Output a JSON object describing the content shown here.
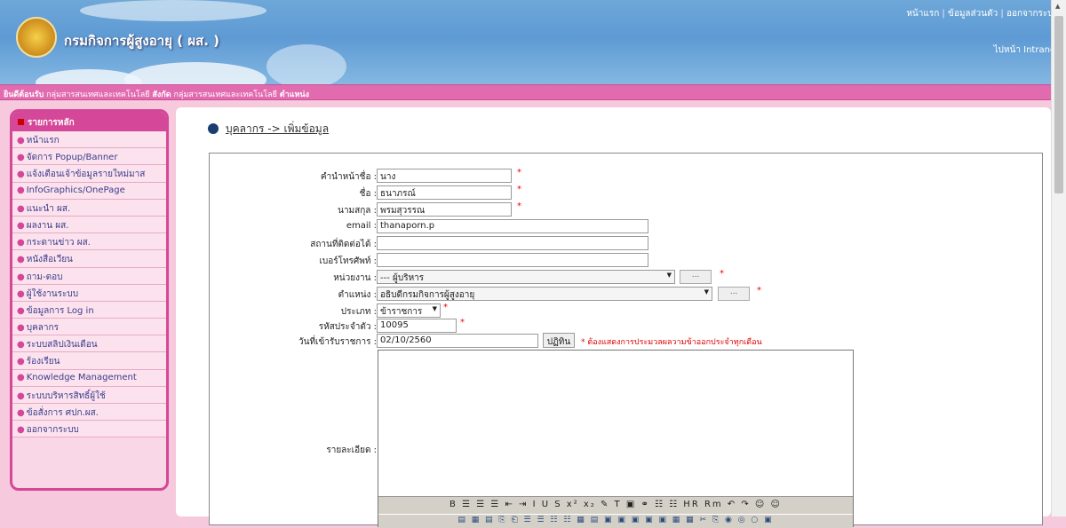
{
  "header": {
    "site_title": "กรมกิจการผู้สูงอายุ ( ผส. )",
    "top_links": [
      "หน้าแรก",
      "ข้อมูลส่วนตัว",
      "ออกจากระบบ"
    ],
    "intranet_link": "ไปหน้า Intranet"
  },
  "welcome_bar": {
    "welcome_label": "ยินดีต้อนรับ",
    "welcome_value": "กลุ่มสารสนเทศและเทคโนโลยี",
    "dept_label": "สังกัด",
    "dept_value": "กลุ่มสารสนเทศและเทคโนโลยี",
    "position_label": "ตำแหน่ง"
  },
  "sidebar": {
    "title": "รายการหลัก",
    "items": [
      {
        "label": "หน้าแรก"
      },
      {
        "label": "จัดการ Popup/Banner"
      },
      {
        "label": "แจ้งเตือนเจ้าข้อมูลรายใหม่มาส"
      },
      {
        "label": "InfoGraphics/OnePage"
      },
      {
        "label": "แนะนำ ผส."
      },
      {
        "label": "ผลงาน ผส."
      },
      {
        "label": "กระดานข่าว ผส."
      },
      {
        "label": "หนังสือเวียน"
      },
      {
        "label": "ถาม-ตอบ"
      },
      {
        "label": "ผู้ใช้งานระบบ"
      },
      {
        "label": "ข้อมูลการ Log in"
      },
      {
        "label": "บุคลากร"
      },
      {
        "label": "ระบบสลิปเงินเดือน"
      },
      {
        "label": "ร้องเรียน"
      },
      {
        "label": "Knowledge Management"
      },
      {
        "label": "ระบบบริหารสิทธิ์ผู้ใช้"
      },
      {
        "label": "ข้อสั่งการ ศปก.ผส."
      },
      {
        "label": "ออกจากระบบ"
      }
    ]
  },
  "main": {
    "breadcrumb": "บุคลากร -> เพิ่มข้อมูล",
    "form": {
      "prefix": {
        "label": "คำนำหน้าชื่อ :",
        "value": "นาง"
      },
      "first_name": {
        "label": "ชื่อ :",
        "value": "ธนาภรณ์"
      },
      "last_name": {
        "label": "นามสกุล :",
        "value": "พรมสุวรรณ"
      },
      "email": {
        "label": "email :",
        "value": "thanaporn.p"
      },
      "address": {
        "label": "สถานที่ติดต่อได้ :",
        "value": ""
      },
      "phone": {
        "label": "เบอร์โทรศัพท์ :",
        "value": ""
      },
      "department": {
        "label": "หน่วยงาน :",
        "value": "--- ผู้บริหาร"
      },
      "position": {
        "label": "ตำแหน่ง :",
        "value": "อธิบดีกรมกิจการผู้สูงอายุ"
      },
      "type": {
        "label": "ประเภท :",
        "value": "ข้าราชการ"
      },
      "employee_id": {
        "label": "รหัสประจำตัว :",
        "value": "10095"
      },
      "start_date": {
        "label": "วันที่เข้ารับราชการ :",
        "value": "02/10/2560"
      },
      "calendar_button": "ปฏิทิน",
      "start_date_note": "* ต้องแสดงการประมวลผลวามข้าออกประจำทุกเดือน",
      "detail_label": "รายละเอียด :",
      "required_mark": "*",
      "dots_button": "...",
      "toolbar1": "B ☰ ☰ ☰ ⇤ ⇥ I U S x² x₂ ✎ T ▣ ⚭ ☷ ☷ HR Rm ↶ ↷ ☺ ☺",
      "toolbar2": "▤ ▦ ▤ ⎘ ⎗ ☰ ☰ ☷ ☷ ▦ ▤ ▣ ▣ ▣ ▣ ▣ ▦ ▦ ✂ ⎘ ◉ ◎ ○ ▣"
    }
  },
  "colors": {
    "header_blue": "#5e9ad4",
    "pink_bar": "#e26bb0",
    "sidebar_border": "#d54798",
    "page_bg": "#f7c9dd",
    "required": "#e00000"
  }
}
